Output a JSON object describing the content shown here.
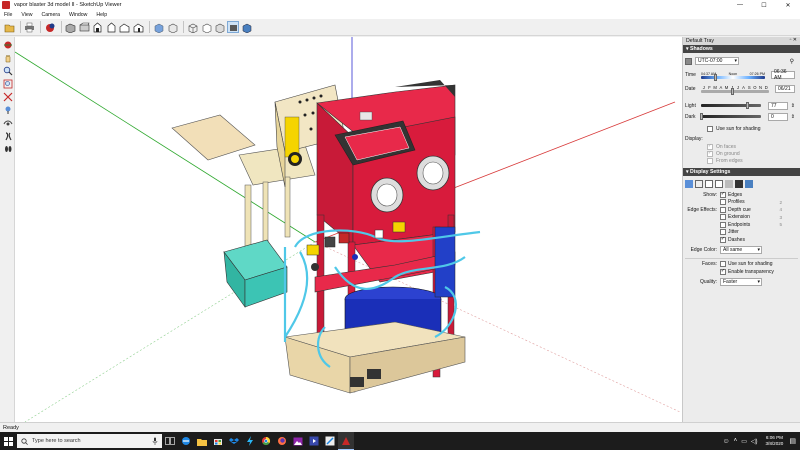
{
  "window": {
    "title": "vapor blaster 3d model II - SketchUp Viewer",
    "controls": [
      "—",
      "☐",
      "✕"
    ]
  },
  "menu": [
    "File",
    "View",
    "Camera",
    "Window",
    "Help"
  ],
  "toolbar": {
    "icons": [
      "open-icon",
      "print-icon",
      "model-info-icon",
      "iso-view-icon",
      "top-view-icon",
      "front-view-icon",
      "right-view-icon",
      "back-view-icon",
      "left-view-icon",
      "xray-icon",
      "back-edges-icon",
      "wireframe-icon",
      "hidden-line-icon",
      "shaded-icon",
      "shaded-textures-icon",
      "monochrome-icon"
    ]
  },
  "left_tools": {
    "icons": [
      "orbit-icon",
      "pan-icon",
      "zoom-icon",
      "zoom-window-icon",
      "zoom-extents-icon",
      "position-camera-icon",
      "look-around-icon",
      "walk-icon",
      "footprint-icon"
    ]
  },
  "status": {
    "text": "Ready"
  },
  "panel": {
    "tray_title": "Default Tray",
    "tray_controls": "▫ ✕",
    "shadows": {
      "title": "Shadows",
      "timezone": "UTC-07:00",
      "time_label": "Time",
      "time_start": "04:37 AM",
      "time_noon": "Noon",
      "time_end": "07:26 PM",
      "time_value": "06:36 AM",
      "time_fraction": 0.22,
      "date_label": "Date",
      "months": [
        "J",
        "F",
        "M",
        "A",
        "M",
        "J",
        "J",
        "A",
        "S",
        "O",
        "N",
        "D"
      ],
      "date_value": "06/21",
      "date_fraction": 0.47,
      "light_label": "Light",
      "light_value": "77",
      "light_fraction": 0.77,
      "dark_label": "Dark",
      "dark_value": "0",
      "dark_fraction": 0.0,
      "use_sun": "Use sun for shading",
      "display_label": "Display:",
      "on_faces": "On faces",
      "on_ground": "On ground",
      "from_edges": "From edges"
    },
    "display_settings": {
      "title": "Display Settings",
      "show_label": "Show:",
      "edges": "Edges",
      "profiles": "Profiles",
      "profiles_val": "2",
      "edge_effects_label": "Edge Effects:",
      "depth_cue": "Depth cue",
      "depth_cue_val": "4",
      "extension": "Extension",
      "extension_val": "3",
      "endpoints": "Endpoints",
      "endpoints_val": "5",
      "jitter": "Jitter",
      "dashes": "Dashes",
      "edge_color_label": "Edge Color:",
      "edge_color_value": "All same",
      "faces_label": "Faces:",
      "use_sun_shading": "Use sun for shading",
      "enable_transparency": "Enable transparency",
      "quality_label": "Quality:",
      "quality_value": "Faster"
    }
  },
  "taskbar": {
    "search_placeholder": "Type here to search",
    "time": "6:06 PM",
    "date": "3/8/2020"
  },
  "colors": {
    "cabinet_red": "#d81b3c",
    "tank_blue": "#1a2fb8",
    "bin_teal": "#3cc4b4",
    "tube_cyan": "#4fc8e8",
    "wood": "#e9d6a8"
  }
}
